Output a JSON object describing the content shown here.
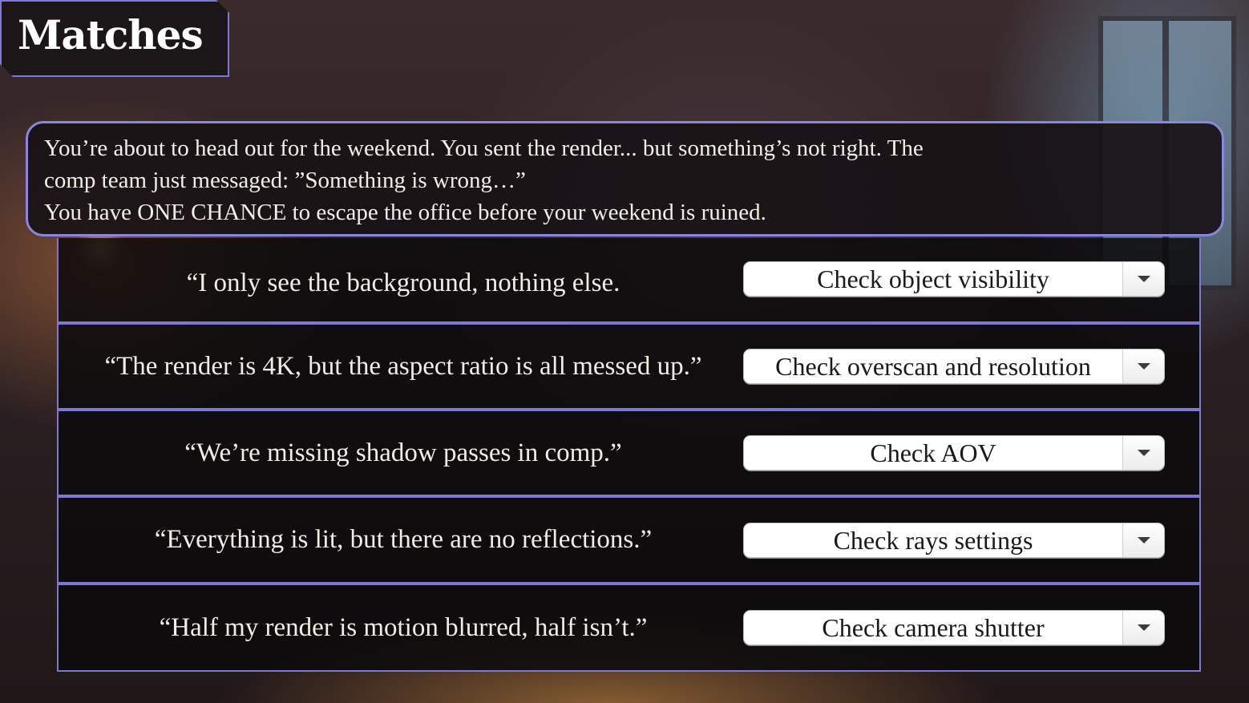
{
  "header": {
    "title": "Matches"
  },
  "intro": {
    "line1": "You’re about to head out for the weekend. You sent the render... but something’s not right. The",
    "line2": "comp team just messaged: ”Something is wrong…”",
    "line3": "You have ONE CHANCE to escape the office before your weekend is ruined."
  },
  "matches": [
    {
      "prompt": "“I only see the background, nothing else.",
      "selected": "Check object visibility",
      "dropdown_icon": "chevron-down-icon"
    },
    {
      "prompt": "“The render is 4K, but the aspect ratio is all messed up.”",
      "selected": "Check overscan and resolution",
      "dropdown_icon": "chevron-down-icon"
    },
    {
      "prompt": "“We’re missing shadow passes in comp.”",
      "selected": "Check AOV",
      "dropdown_icon": "chevron-down-icon"
    },
    {
      "prompt": "“Everything is lit, but there are no reflections.”",
      "selected": "Check rays settings",
      "dropdown_icon": "chevron-down-icon"
    },
    {
      "prompt": "“Half my render is motion blurred, half isn’t.”",
      "selected": "Check camera shutter",
      "dropdown_icon": "chevron-down-icon"
    }
  ],
  "colors": {
    "accent": "#7d78d4",
    "panel": "#1d1619",
    "text": "#f1ede6"
  }
}
